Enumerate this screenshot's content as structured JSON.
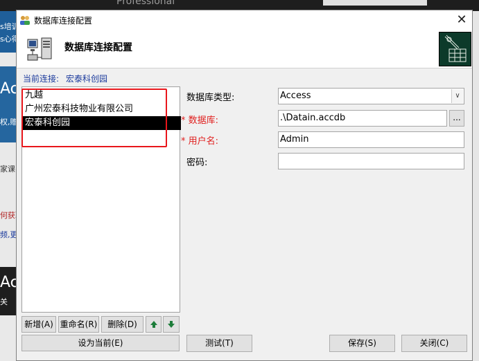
{
  "background": {
    "left_fragments": [
      "s培训",
      "s心得",
      "Ac",
      "权,贈",
      "家课",
      "何获取",
      "频,更",
      "Ac",
      "关"
    ],
    "top_fragment": "Professional"
  },
  "dialog": {
    "title": "数据库连接配置",
    "close_glyph": "✕",
    "header_title": "数据库连接配置"
  },
  "current": {
    "label": "当前连接:",
    "value": "宏泰科创园"
  },
  "connections": [
    {
      "label": "九越",
      "selected": false
    },
    {
      "label": "广州宏泰科技物业有限公司",
      "selected": false
    },
    {
      "label": "宏泰科创园",
      "selected": true
    }
  ],
  "list_buttons": {
    "add": "新增(A)",
    "rename": "重命名(R)",
    "delete": "删除(D)",
    "up_icon": "arrow-up",
    "down_icon": "arrow-down",
    "set_current": "设为当前(E)"
  },
  "form": {
    "db_type_label": "数据库类型:",
    "db_type_value": "Access",
    "database_label": "数据库:",
    "database_value": ".\\Datain.accdb",
    "browse_label": "...",
    "username_label": "用户名:",
    "username_value": "Admin",
    "password_label": "密码:",
    "password_value": "",
    "required_mark": "*"
  },
  "footer": {
    "test": "测试(T)",
    "save": "保存(S)",
    "close": "关闭(C)"
  },
  "colors": {
    "accent_blue": "#1b3a9c",
    "required_red": "#e0201f",
    "highlight_box": "#e8161b",
    "selected_bg": "#000000"
  }
}
